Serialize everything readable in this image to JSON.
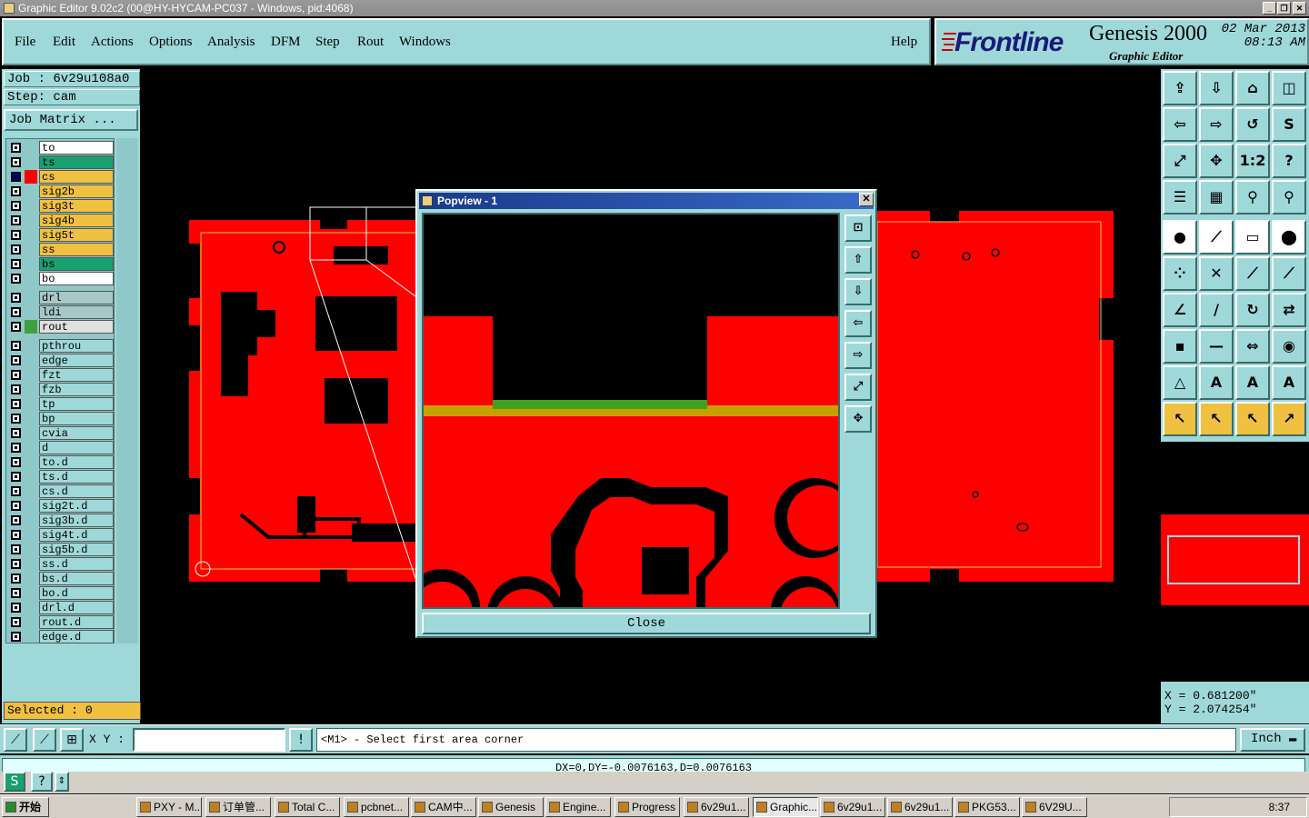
{
  "window": {
    "title": "Graphic Editor 9.02c2 (00@HY-HYCAM-PC037 - Windows, pid:4068)",
    "controls": [
      "_",
      "❐",
      "✕"
    ]
  },
  "menu": {
    "items": [
      "File",
      "Edit",
      "Actions",
      "Options",
      "Analysis",
      "DFM",
      "Step",
      "Rout",
      "Windows"
    ],
    "help": "Help"
  },
  "brand": {
    "logo": "Frontline",
    "product": "Genesis 2000",
    "subtitle": "Graphic Editor",
    "date": "02 Mar 2013",
    "time": "08:13 AM"
  },
  "job": {
    "job_label": "Job  : 6v29u108a0",
    "step_label": "Step: cam",
    "matrix_button": "Job Matrix ..."
  },
  "layers": [
    {
      "name": "to",
      "color": "#ffffff",
      "swatch": ""
    },
    {
      "name": "ts",
      "color": "#1aa070",
      "swatch": ""
    },
    {
      "name": "cs",
      "color": "#f0c040",
      "swatch": "#ff0000",
      "active": true
    },
    {
      "name": "sig2b",
      "color": "#f0c040",
      "swatch": ""
    },
    {
      "name": "sig3t",
      "color": "#f0c040",
      "swatch": ""
    },
    {
      "name": "sig4b",
      "color": "#f0c040",
      "swatch": ""
    },
    {
      "name": "sig5t",
      "color": "#f0c040",
      "swatch": ""
    },
    {
      "name": "ss",
      "color": "#f0c040",
      "swatch": ""
    },
    {
      "name": "bs",
      "color": "#1aa070",
      "swatch": ""
    },
    {
      "name": "bo",
      "color": "#ffffff",
      "swatch": ""
    },
    {
      "name": "drl",
      "color": "#a8c8c8",
      "swatch": ""
    },
    {
      "name": "ldi",
      "color": "#a8c8c8",
      "swatch": ""
    },
    {
      "name": "rout",
      "color": "#e0e0e0",
      "swatch": "#40a040"
    },
    {
      "name": "pthrou",
      "color": "#9fd8d8",
      "swatch": ""
    },
    {
      "name": "edge",
      "color": "#9fd8d8",
      "swatch": ""
    },
    {
      "name": "fzt",
      "color": "#9fd8d8",
      "swatch": ""
    },
    {
      "name": "fzb",
      "color": "#9fd8d8",
      "swatch": ""
    },
    {
      "name": "tp",
      "color": "#9fd8d8",
      "swatch": ""
    },
    {
      "name": "bp",
      "color": "#9fd8d8",
      "swatch": ""
    },
    {
      "name": "cvia",
      "color": "#9fd8d8",
      "swatch": ""
    },
    {
      "name": "d",
      "color": "#9fd8d8",
      "swatch": ""
    },
    {
      "name": "to.d",
      "color": "#9fd8d8",
      "swatch": ""
    },
    {
      "name": "ts.d",
      "color": "#9fd8d8",
      "swatch": ""
    },
    {
      "name": "cs.d",
      "color": "#9fd8d8",
      "swatch": ""
    },
    {
      "name": "sig2t.d",
      "color": "#9fd8d8",
      "swatch": ""
    },
    {
      "name": "sig3b.d",
      "color": "#9fd8d8",
      "swatch": ""
    },
    {
      "name": "sig4t.d",
      "color": "#9fd8d8",
      "swatch": ""
    },
    {
      "name": "sig5b.d",
      "color": "#9fd8d8",
      "swatch": ""
    },
    {
      "name": "ss.d",
      "color": "#9fd8d8",
      "swatch": ""
    },
    {
      "name": "bs.d",
      "color": "#9fd8d8",
      "swatch": ""
    },
    {
      "name": "bo.d",
      "color": "#9fd8d8",
      "swatch": ""
    },
    {
      "name": "drl.d",
      "color": "#9fd8d8",
      "swatch": ""
    },
    {
      "name": "rout.d",
      "color": "#9fd8d8",
      "swatch": ""
    },
    {
      "name": "edge.d",
      "color": "#9fd8d8",
      "swatch": ""
    }
  ],
  "selected": "Selected : 0",
  "popview": {
    "title": "Popview - 1",
    "close_label": "Close"
  },
  "coords": {
    "x": "X  = 0.681200\"",
    "y": "Y  = 2.074254\""
  },
  "bottom": {
    "xy_label": "X Y :",
    "xy_value": "",
    "prompt": "<M1> - Select first area corner",
    "unit": "Inch",
    "status": "DX=0,DY=-0.0076163,D=0.0076163"
  },
  "taskbar": {
    "start": "开始",
    "tasks": [
      "PXY - M...",
      "订单管...",
      "Total C...",
      "pcbnet...",
      "CAM中...",
      "Genesis",
      "Engine...",
      "Progress",
      "6v29u1...",
      "Graphic...",
      "6v29u1...",
      "6v29u1...",
      "PKG53...",
      "6V29U..."
    ],
    "clock": "8:37"
  },
  "colors": {
    "panel": "#9fd8d8",
    "copper": "#ff0000",
    "outline": "#f0c040"
  }
}
